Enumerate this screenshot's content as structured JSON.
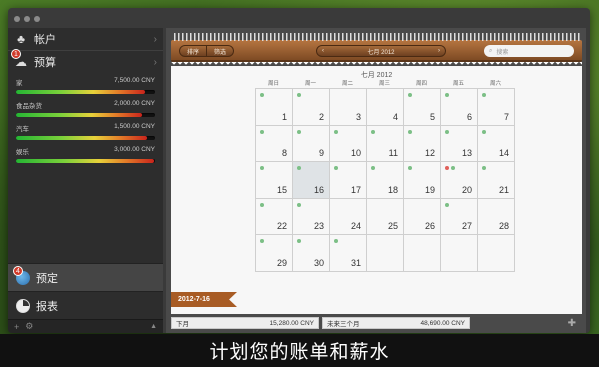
{
  "sidebar": {
    "accounts_label": "帐户",
    "budget_label": "预算",
    "budget_badge": "1",
    "budgets": [
      {
        "name": "家",
        "amount": "7,500.00 CNY",
        "fill": 0.93
      },
      {
        "name": "食品杂货",
        "amount": "2,000.00 CNY",
        "fill": 0.91
      },
      {
        "name": "汽车",
        "amount": "1,500.00 CNY",
        "fill": 0.94
      },
      {
        "name": "娱乐",
        "amount": "3,000.00 CNY",
        "fill": 0.99
      }
    ],
    "scheduled_label": "预定",
    "scheduled_badge": "4",
    "reports_label": "报表"
  },
  "toolbar": {
    "sort_label": "排序",
    "filter_label": "筛选",
    "month_label": "七月 2012",
    "search_placeholder": "搜索"
  },
  "calendar": {
    "title": "七月 2012",
    "weekdays": [
      "周日",
      "周一",
      "周二",
      "周三",
      "周四",
      "周五",
      "周六"
    ],
    "today": 16,
    "colors": {
      "green": "#7cbf86",
      "red": "#e0605a"
    },
    "days": [
      {
        "n": 1,
        "dots": [
          "green"
        ]
      },
      {
        "n": 2,
        "dots": [
          "green"
        ]
      },
      {
        "n": 3,
        "dots": []
      },
      {
        "n": 4,
        "dots": []
      },
      {
        "n": 5,
        "dots": [
          "green"
        ]
      },
      {
        "n": 6,
        "dots": [
          "green"
        ]
      },
      {
        "n": 7,
        "dots": [
          "green"
        ]
      },
      {
        "n": 8,
        "dots": [
          "green"
        ]
      },
      {
        "n": 9,
        "dots": [
          "green"
        ]
      },
      {
        "n": 10,
        "dots": [
          "green"
        ]
      },
      {
        "n": 11,
        "dots": [
          "green"
        ]
      },
      {
        "n": 12,
        "dots": [
          "green"
        ]
      },
      {
        "n": 13,
        "dots": [
          "green"
        ]
      },
      {
        "n": 14,
        "dots": [
          "green"
        ]
      },
      {
        "n": 15,
        "dots": [
          "green"
        ]
      },
      {
        "n": 16,
        "dots": [
          "green"
        ]
      },
      {
        "n": 17,
        "dots": [
          "green"
        ]
      },
      {
        "n": 18,
        "dots": [
          "green"
        ]
      },
      {
        "n": 19,
        "dots": [
          "green"
        ]
      },
      {
        "n": 20,
        "dots": [
          "red",
          "green"
        ]
      },
      {
        "n": 21,
        "dots": [
          "green"
        ]
      },
      {
        "n": 22,
        "dots": [
          "green"
        ]
      },
      {
        "n": 23,
        "dots": [
          "green"
        ]
      },
      {
        "n": 24,
        "dots": []
      },
      {
        "n": 25,
        "dots": []
      },
      {
        "n": 26,
        "dots": []
      },
      {
        "n": 27,
        "dots": [
          "green"
        ]
      },
      {
        "n": 28,
        "dots": []
      },
      {
        "n": 29,
        "dots": [
          "green"
        ]
      },
      {
        "n": 30,
        "dots": [
          "green"
        ]
      },
      {
        "n": 31,
        "dots": [
          "green"
        ]
      }
    ],
    "selected_date": "2012-7-16"
  },
  "totals": {
    "next_month_label": "下月",
    "next_month_value": "15,280.00 CNY",
    "next_three_label": "未来三个月",
    "next_three_value": "48,690.00 CNY"
  },
  "caption": "计划您的账单和薪水"
}
